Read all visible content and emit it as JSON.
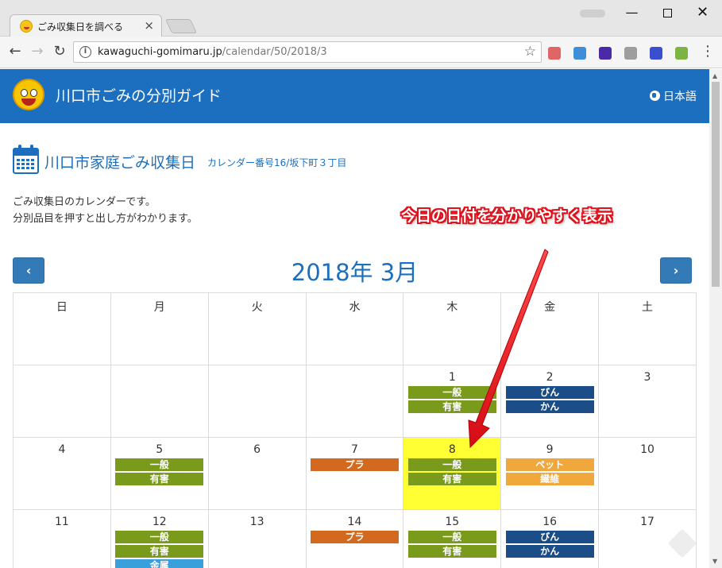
{
  "browser": {
    "tab_title": "ごみ収集日を調べる",
    "tab_close": "×",
    "url_domain": "kawaguchi-gomimaru.jp",
    "url_path": "/calendar/50/2018/3",
    "min_label": "—",
    "close_label": "✕",
    "extension_colors": [
      "#e06666",
      "#3f8fd8",
      "#4b2aa8",
      "#9e9e9e",
      "#3a4fd0",
      "#7cb342"
    ]
  },
  "header": {
    "site_title": "川口市ごみの分別ガイド",
    "language": "日本語"
  },
  "main": {
    "title": "川口市家庭ごみ収集日",
    "subtitle": "カレンダー番号16/坂下町３丁目",
    "desc_line1": "ごみ収集日のカレンダーです。",
    "desc_line2": "分別品目を押すと出し方がわかります。",
    "annotation": "今日の日付を分かりやすく表示",
    "month_title": "2018年 3月",
    "prev_label": "‹",
    "next_label": "›"
  },
  "calendar": {
    "weekdays": [
      "日",
      "月",
      "火",
      "水",
      "木",
      "金",
      "土"
    ],
    "today": "8",
    "weeks": [
      [
        {
          "day": "",
          "items": []
        },
        {
          "day": "",
          "items": []
        },
        {
          "day": "",
          "items": []
        },
        {
          "day": "",
          "items": []
        },
        {
          "day": "1",
          "items": [
            {
              "label": "一般",
              "type": "general"
            },
            {
              "label": "有害",
              "type": "hazard"
            }
          ]
        },
        {
          "day": "2",
          "items": [
            {
              "label": "びん",
              "type": "bottle"
            },
            {
              "label": "かん",
              "type": "can"
            }
          ]
        },
        {
          "day": "3",
          "items": []
        }
      ],
      [
        {
          "day": "4",
          "items": []
        },
        {
          "day": "5",
          "items": [
            {
              "label": "一般",
              "type": "general"
            },
            {
              "label": "有害",
              "type": "hazard"
            }
          ]
        },
        {
          "day": "6",
          "items": []
        },
        {
          "day": "7",
          "items": [
            {
              "label": "プラ",
              "type": "plastic"
            }
          ]
        },
        {
          "day": "8",
          "items": [
            {
              "label": "一般",
              "type": "general"
            },
            {
              "label": "有害",
              "type": "hazard"
            }
          ]
        },
        {
          "day": "9",
          "items": [
            {
              "label": "ペット",
              "type": "pet"
            },
            {
              "label": "繊維",
              "type": "fiber"
            }
          ]
        },
        {
          "day": "10",
          "items": []
        }
      ],
      [
        {
          "day": "11",
          "items": []
        },
        {
          "day": "12",
          "items": [
            {
              "label": "一般",
              "type": "general"
            },
            {
              "label": "有害",
              "type": "hazard"
            },
            {
              "label": "金属",
              "type": "metal"
            }
          ]
        },
        {
          "day": "13",
          "items": []
        },
        {
          "day": "14",
          "items": [
            {
              "label": "プラ",
              "type": "plastic"
            }
          ]
        },
        {
          "day": "15",
          "items": [
            {
              "label": "一般",
              "type": "general"
            },
            {
              "label": "有害",
              "type": "hazard"
            }
          ]
        },
        {
          "day": "16",
          "items": [
            {
              "label": "びん",
              "type": "bottle"
            },
            {
              "label": "かん",
              "type": "can"
            }
          ]
        },
        {
          "day": "17",
          "items": []
        }
      ]
    ]
  },
  "colors": {
    "brand": "#1b6fbe",
    "today_highlight": "#ffff33",
    "annotation_red": "#e0111b"
  }
}
